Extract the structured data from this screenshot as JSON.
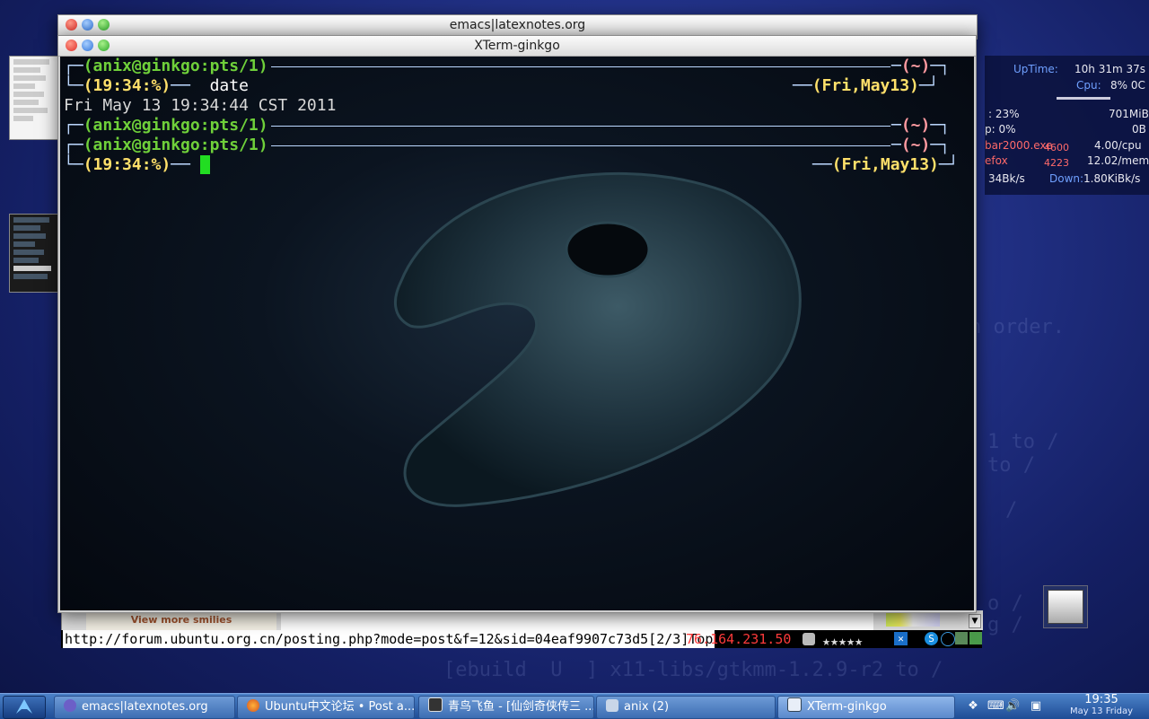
{
  "desktop": {
    "bg_text": [
      "n order.",
      "1 to /",
      "to /",
      "/",
      "o /",
      "g /",
      "[ebuild  U  ] x11-libs/gtkmm-1.2.9-r2 to /"
    ]
  },
  "conky": {
    "uptime_label": "UpTime:",
    "uptime_value": "10h 31m 37s",
    "cpu_label": "Cpu:",
    "cpu_value": "8% 0C",
    "mem_pct": ": 23%",
    "mem_value": "701MiB",
    "swap_pct": "p: 0%",
    "swap_value": "0B",
    "proc1_name": "bar2000.exe",
    "proc1_pid": "4600",
    "proc1_val": "4.00/cpu",
    "proc2_name": "efox",
    "proc2_pid": "4223",
    "proc2_val": "12.02/mem",
    "up_value": "34Bk/s",
    "down_label": "Down:",
    "down_value": "1.80KiBk/s"
  },
  "emacs_window": {
    "title": "emacs|latexnotes.org"
  },
  "xterm_window": {
    "title": "XTerm-ginkgo",
    "lines": {
      "user1": "(anix@ginkgo:pts/1)",
      "home1": "(~)",
      "time1": "(19:34:%)",
      "cmd": " date",
      "date1": "(Fri,May13)",
      "output": "Fri May 13 19:34:44 CST 2011",
      "user2": "(anix@ginkgo:pts/1)",
      "home2": "(~)",
      "user3": "(anix@ginkgo:pts/1)",
      "home3": "(~)",
      "time3": "(19:34:%)",
      "date3": "(Fri,May13)"
    }
  },
  "browser": {
    "smilies_link": "View more smilies",
    "status_url": "http://forum.ubuntu.org.cn/posting.php?mode=post&f=12&sid=04eaf9907c73d5[2/3]Top",
    "status_ip": "76.164.231.50"
  },
  "taskbar": {
    "tasks": [
      {
        "label": "emacs|latexnotes.org",
        "icon": "emacs-icon"
      },
      {
        "label": "Ubuntu中文论坛 • Post a...",
        "icon": "firefox-icon"
      },
      {
        "label": "青鸟飞鱼 - [仙剑奇侠传三 ...",
        "icon": "game-icon"
      },
      {
        "label": "anix (2)",
        "icon": "folder-icon"
      },
      {
        "label": "XTerm-ginkgo",
        "icon": "terminal-icon"
      }
    ],
    "clock_time": "19:35",
    "clock_date": "May 13 Friday"
  }
}
